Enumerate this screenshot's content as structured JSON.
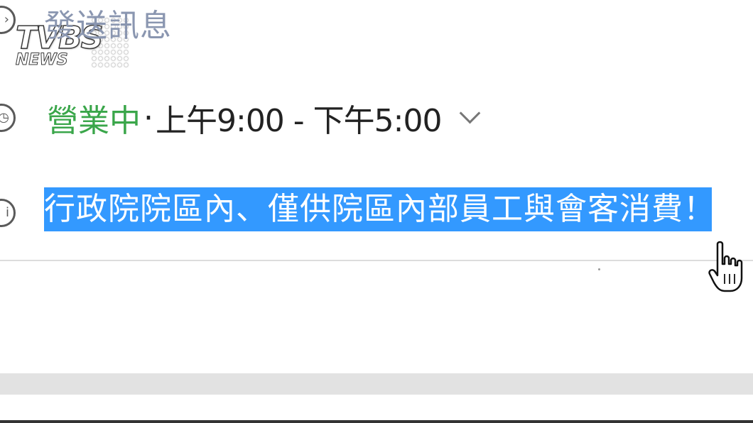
{
  "watermark": {
    "brand": "TVBS",
    "sub": "NEWS"
  },
  "info_panel": {
    "send_message_label": "發送訊息",
    "hours": {
      "status": "營業中",
      "separator": "·",
      "range": "上午9:00 - 下午5:00"
    },
    "note": "行政院院區內、僅供院區內部員工與會客消費！"
  },
  "colors": {
    "status_open": "#3aa64a",
    "selection_bg": "#3399ff",
    "send_message_text": "#8a96b0"
  },
  "icons": {
    "send": "circle-chevron-icon",
    "hours": "clock-icon",
    "info": "info-icon",
    "expand": "chevron-down-icon",
    "pointer": "hand-cursor-icon"
  }
}
